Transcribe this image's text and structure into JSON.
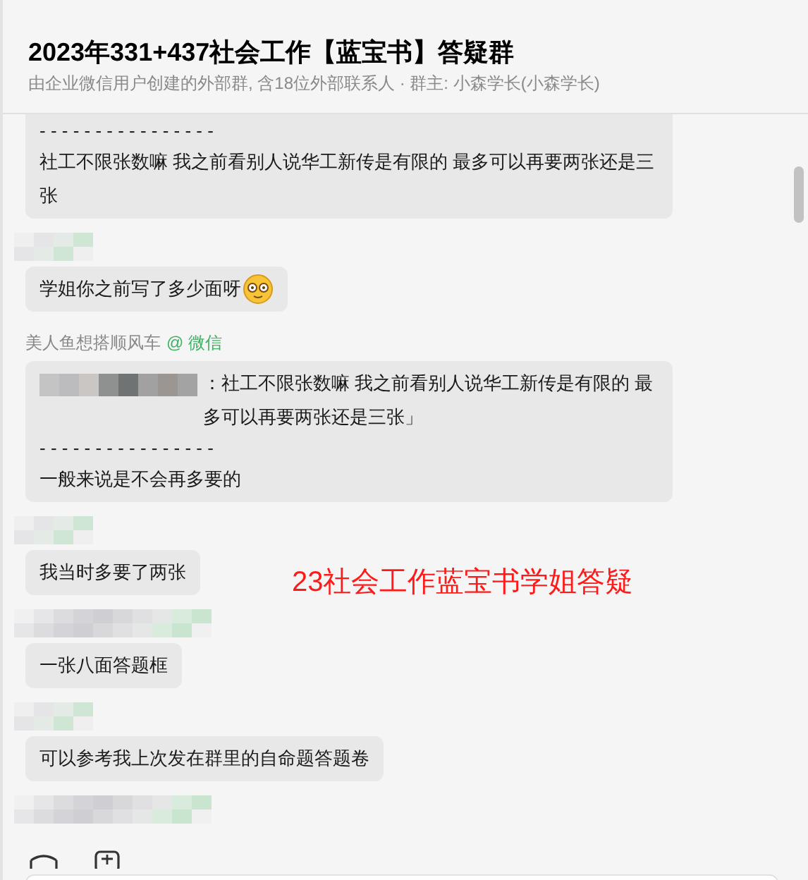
{
  "header": {
    "title": "2023年331+437社会工作【蓝宝书】答疑群",
    "subtitle": "由企业微信用户创建的外部群, 含18位外部联系人 · 群主: 小森学长(小森学长)"
  },
  "messages": [
    {
      "kind": "plain",
      "cut_top": true,
      "parts": [
        {
          "kind": "divider",
          "text": "- - - - - - - - - - - - - - - -"
        },
        {
          "kind": "text",
          "text": "社工不限张数嘛 我之前看别人说华工新传是有限的 最多可以再要两张还是三张"
        }
      ]
    },
    {
      "kind": "blurred",
      "parts": [
        {
          "kind": "text",
          "text": "学姐你之前写了多少面呀",
          "emoji": true
        }
      ]
    },
    {
      "kind": "named",
      "sender": "美人鱼想搭顺风车",
      "source": "@ 微信",
      "parts": [
        {
          "kind": "quote",
          "text": "：社工不限张数嘛 我之前看别人说华工新传是有限的 最多可以再要两张还是三张」"
        },
        {
          "kind": "divider",
          "text": "- - - - - - - - - - - - - - - -"
        },
        {
          "kind": "text",
          "text": "一般来说是不会再多要的"
        }
      ]
    },
    {
      "kind": "blurred",
      "parts": [
        {
          "kind": "text",
          "text": "我当时多要了两张"
        }
      ]
    },
    {
      "kind": "blurred",
      "parts": [
        {
          "kind": "text",
          "text": "一张八面答题框"
        }
      ]
    },
    {
      "kind": "blurred",
      "parts": [
        {
          "kind": "text",
          "text": "可以参考我上次发在群里的自命题答题卷"
        }
      ]
    },
    {
      "kind": "blurred_only"
    }
  ],
  "overlay_caption": "23社会工作蓝宝书学姐答疑"
}
